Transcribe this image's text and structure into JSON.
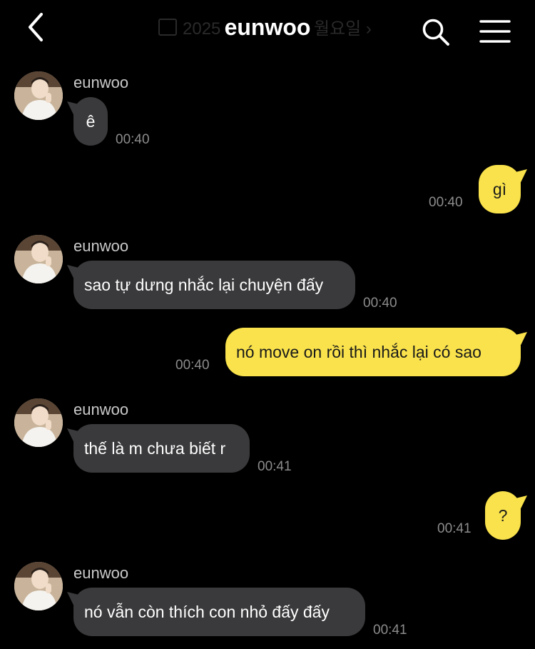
{
  "header": {
    "title": "eunwoo",
    "back_icon": "chevron-left-icon",
    "search_icon": "search-icon",
    "menu_icon": "hamburger-menu-icon",
    "date_ghost_start": "2025",
    "date_ghost_end": "월요일 ›"
  },
  "contact": {
    "name": "eunwoo"
  },
  "messages": [
    {
      "direction": "in",
      "sender": "eunwoo",
      "text": "ê",
      "time": "00:40"
    },
    {
      "direction": "out",
      "text": "gì",
      "time": "00:40"
    },
    {
      "direction": "in",
      "sender": "eunwoo",
      "text": "sao tự dưng nhắc lại chuyện đấy",
      "time": "00:40"
    },
    {
      "direction": "out",
      "text": "nó move on rồi thì nhắc lại có sao",
      "time": "00:40"
    },
    {
      "direction": "in",
      "sender": "eunwoo",
      "text": "thế là m chưa biết r",
      "time": "00:41"
    },
    {
      "direction": "out",
      "text": "?",
      "time": "00:41"
    },
    {
      "direction": "in",
      "sender": "eunwoo",
      "text": "nó vẫn còn thích con nhỏ đấy đấy",
      "time": "00:41"
    }
  ],
  "colors": {
    "background": "#000000",
    "incoming_bubble": "#3a3a3c",
    "outgoing_bubble": "#f9e24b",
    "timestamp": "#8c8c8c",
    "sender_name": "#c9c9c9"
  }
}
